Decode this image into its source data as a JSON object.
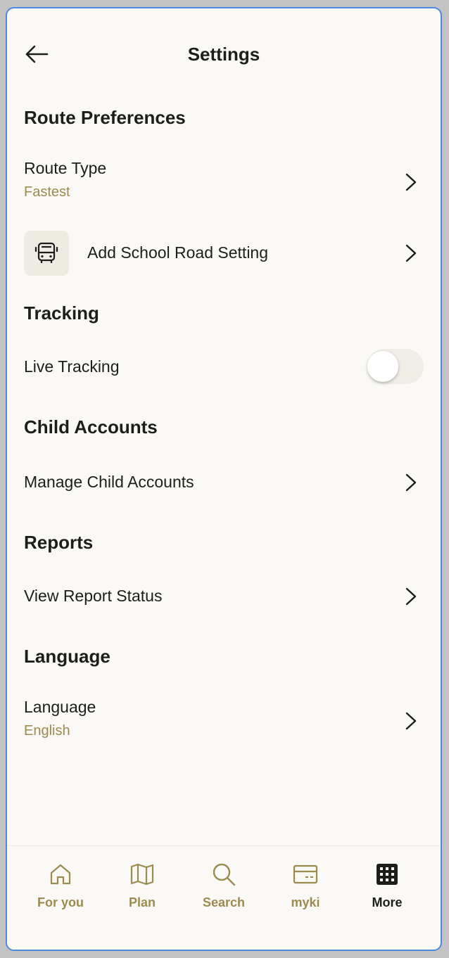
{
  "header": {
    "title": "Settings",
    "back_icon": "arrow-left-icon"
  },
  "sections": {
    "route": {
      "title": "Route Preferences",
      "route_type": {
        "label": "Route Type",
        "value": "Fastest"
      },
      "school_road": {
        "label": "Add School Road Setting",
        "icon": "bus-icon"
      }
    },
    "tracking": {
      "title": "Tracking",
      "live_tracking": {
        "label": "Live Tracking",
        "enabled": false
      }
    },
    "child": {
      "title": "Child Accounts",
      "manage": {
        "label": "Manage Child Accounts"
      }
    },
    "reports": {
      "title": "Reports",
      "status": {
        "label": "View Report Status"
      }
    },
    "language": {
      "title": "Language",
      "language": {
        "label": "Language",
        "value": "English"
      }
    }
  },
  "tabbar": {
    "items": [
      {
        "label": "For you",
        "icon": "home-icon",
        "active": false
      },
      {
        "label": "Plan",
        "icon": "map-icon",
        "active": false
      },
      {
        "label": "Search",
        "icon": "search-icon",
        "active": false
      },
      {
        "label": "myki",
        "icon": "card-icon",
        "active": false
      },
      {
        "label": "More",
        "icon": "grid-icon",
        "active": true
      }
    ]
  },
  "colors": {
    "accent": "#9c8a4f",
    "text": "#1d1d1b",
    "background": "#faf9f6",
    "frame": "#4b89e0"
  }
}
